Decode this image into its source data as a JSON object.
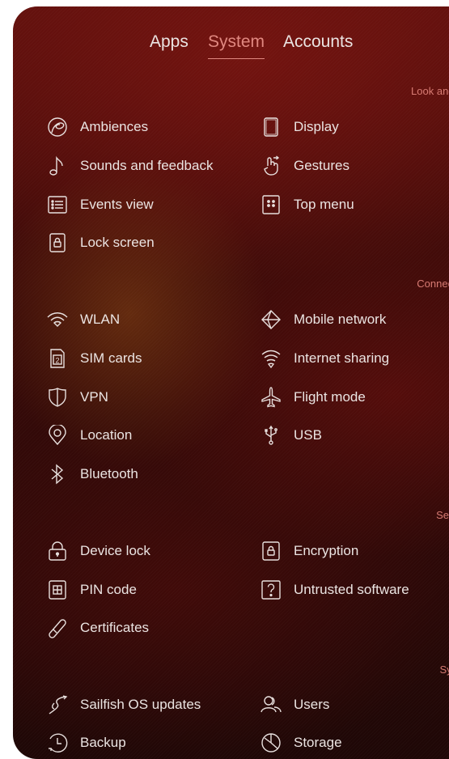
{
  "tabs": [
    "Apps",
    "System",
    "Accounts"
  ],
  "sections": {
    "look": {
      "header": "Look and fe"
    },
    "connectivity": {
      "header": "Connectivi"
    },
    "security": {
      "header": "Securi"
    },
    "system": {
      "header": "Syste"
    }
  },
  "items": {
    "ambiences": "Ambiences",
    "display": "Display",
    "sounds": "Sounds and feedback",
    "gestures": "Gestures",
    "events": "Events view",
    "topmenu": "Top menu",
    "lockscreen": "Lock screen",
    "wlan": "WLAN",
    "mobile": "Mobile network",
    "sim": "SIM cards",
    "sharing": "Internet sharing",
    "vpn": "VPN",
    "flight": "Flight mode",
    "location": "Location",
    "usb": "USB",
    "bluetooth": "Bluetooth",
    "devicelock": "Device lock",
    "encryption": "Encryption",
    "pin": "PIN code",
    "untrusted": "Untrusted software",
    "certificates": "Certificates",
    "updates": "Sailfish OS updates",
    "users": "Users",
    "backup": "Backup",
    "storage": "Storage"
  },
  "sim_icon_digit": "2",
  "colors": {
    "accent": "#e0877f",
    "section_header": "#d77a72",
    "text": "#ebe4e2"
  }
}
